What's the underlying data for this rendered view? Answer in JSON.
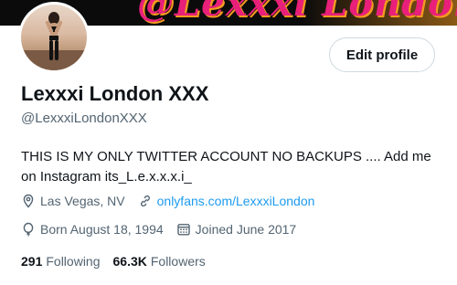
{
  "banner": {
    "text": "@Lexxxi London"
  },
  "profile": {
    "name": "Lexxxi London XXX",
    "handle": "@LexxxiLondonXXX",
    "bio": "THIS IS MY ONLY TWITTER ACCOUNT NO BACKUPS .... Add me on Instagram its_L.e.x.x.x.i_",
    "location": "Las Vegas, NV",
    "website": "onlyfans.com/LexxxiLondon",
    "birthday": "Born August 18, 1994",
    "joined": "Joined June 2017"
  },
  "actions": {
    "edit_profile": "Edit profile"
  },
  "stats": {
    "following_count": "291",
    "following_label": "Following",
    "followers_count": "66.3K",
    "followers_label": "Followers"
  },
  "colors": {
    "link": "#1d9bf0",
    "secondary_text": "#536471",
    "banner_pink": "#e8207a",
    "banner_orange": "#f39a1e"
  },
  "icons": [
    "location-icon",
    "link-icon",
    "balloon-icon",
    "calendar-icon"
  ]
}
